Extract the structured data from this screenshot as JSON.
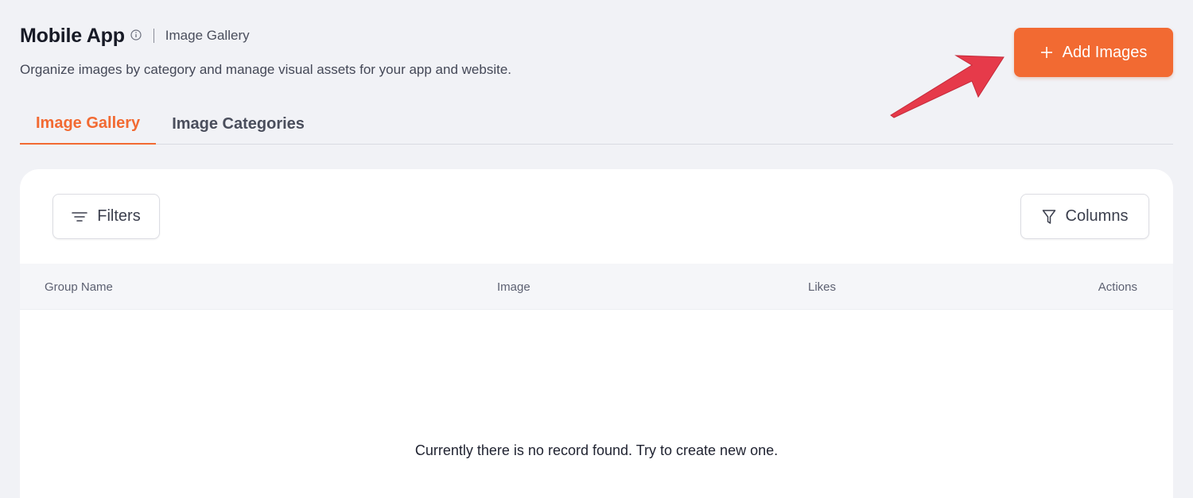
{
  "header": {
    "title": "Mobile App",
    "breadcrumb_current": "Image Gallery",
    "description": "Organize images by category and manage visual assets for your app and website."
  },
  "actions": {
    "add_images_label": "Add Images"
  },
  "tabs": [
    {
      "label": "Image Gallery",
      "active": true
    },
    {
      "label": "Image Categories",
      "active": false
    }
  ],
  "toolbar": {
    "filters_label": "Filters",
    "columns_label": "Columns"
  },
  "table": {
    "columns": [
      "Group Name",
      "Image",
      "Likes",
      "Actions"
    ],
    "empty_message": "Currently there is no record found. Try to create new one."
  },
  "icons": {
    "info": "info-circle-icon",
    "plus": "plus-icon",
    "filters": "filter-lines-icon",
    "columns": "funnel-icon",
    "annotation": "red-arrow-icon"
  },
  "colors": {
    "accent": "#f26a32",
    "background": "#f1f2f6",
    "annotation_arrow": "#e63a4a"
  }
}
